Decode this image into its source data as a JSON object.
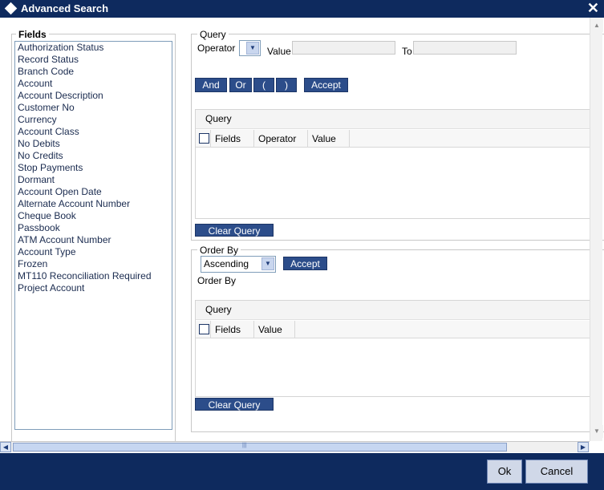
{
  "window": {
    "title": "Advanced Search",
    "close_glyph": "✕"
  },
  "fields": {
    "legend": "Fields",
    "items": [
      "Authorization Status",
      "Record Status",
      "Branch Code",
      "Account",
      "Account Description",
      "Customer No",
      "Currency",
      "Account Class",
      "No Debits",
      "No Credits",
      "Stop Payments",
      "Dormant",
      "Account Open Date",
      "Alternate Account Number",
      "Cheque Book",
      "Passbook",
      "ATM Account Number",
      "Account Type",
      "Frozen",
      "MT110 Reconciliation Required",
      "Project Account"
    ]
  },
  "query": {
    "legend": "Query",
    "operator_label": "Operator",
    "operator_value": "",
    "value_label": "Value",
    "value_value": "",
    "to_label": "To",
    "to_value": "",
    "buttons": {
      "and": "And",
      "or": "Or",
      "open_paren": "(",
      "close_paren": ")",
      "accept": "Accept"
    },
    "table": {
      "title": "Query",
      "columns": [
        "Fields",
        "Operator",
        "Value"
      ],
      "rows": []
    },
    "clear_label": "Clear Query"
  },
  "order_by": {
    "legend": "Order By",
    "sort_value": "Ascending",
    "accept_label": "Accept",
    "order_by_label": "Order By",
    "table": {
      "title": "Query",
      "columns": [
        "Fields",
        "Value"
      ],
      "rows": []
    },
    "clear_label": "Clear Query"
  },
  "footer": {
    "ok_label": "Ok",
    "cancel_label": "Cancel"
  },
  "colors": {
    "titlebar": "#0e2a5e",
    "button": "#2c4d8a",
    "list_text": "#1a2b4f"
  },
  "icons": {
    "window": "diamond-icon",
    "close": "close-icon",
    "dropdown": "chevron-down-icon"
  }
}
